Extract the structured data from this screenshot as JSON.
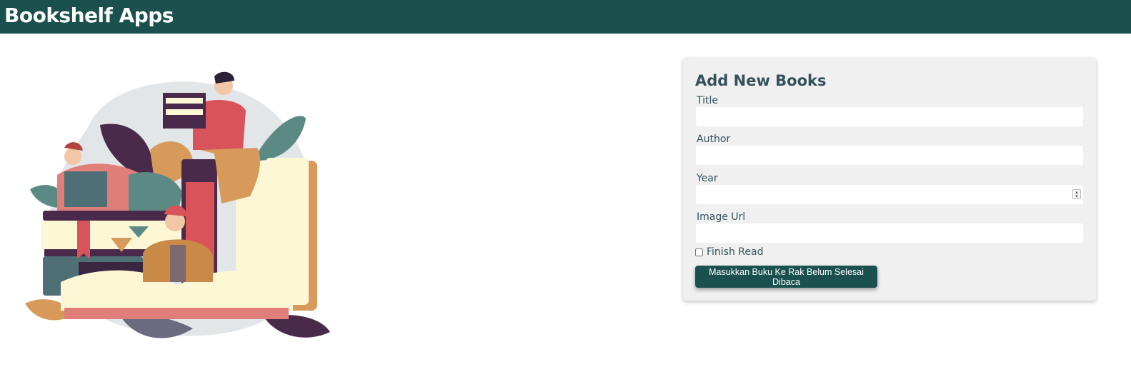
{
  "header": {
    "title": "Bookshelf Apps"
  },
  "form": {
    "heading": "Add New Books",
    "fields": [
      {
        "label": "Title",
        "value": "",
        "type": "text"
      },
      {
        "label": "Author",
        "value": "",
        "type": "text"
      },
      {
        "label": "Year",
        "value": "",
        "type": "number"
      },
      {
        "label": "Image Url",
        "value": "",
        "type": "text"
      }
    ],
    "checkbox": {
      "label": "Finish Read",
      "checked": false
    },
    "submit_label": "Masukkan Buku Ke Rak Belum Selesai Dibaca"
  },
  "illustration": {
    "icon": "people-reading-books-illustration"
  },
  "colors": {
    "header_bg": "#1a514e",
    "card_bg": "#f0f0f0",
    "text": "#33505b",
    "button_bg": "#1a514e"
  }
}
